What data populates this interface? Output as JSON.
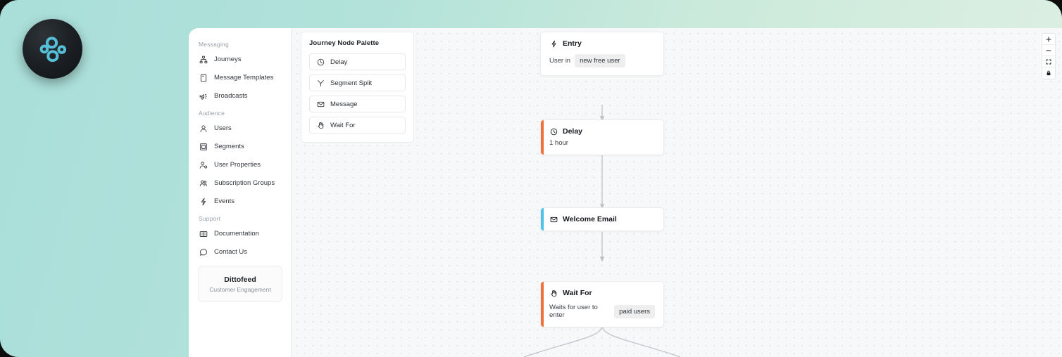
{
  "brand": {
    "logo_icon": "dittofeed-petals-logo",
    "accent_color": "#56bfd8",
    "badge_color": "#16191d"
  },
  "background": {
    "gradient_from": "#a9ded9",
    "gradient_to": "#dff0e3"
  },
  "sidebar": {
    "groups": [
      {
        "label": "Messaging",
        "items": [
          {
            "label": "Journeys",
            "icon": "sitemap-icon"
          },
          {
            "label": "Message Templates",
            "icon": "document-icon"
          },
          {
            "label": "Broadcasts",
            "icon": "megaphone-icon"
          }
        ]
      },
      {
        "label": "Audience",
        "items": [
          {
            "label": "Users",
            "icon": "user-icon"
          },
          {
            "label": "Segments",
            "icon": "segments-icon"
          },
          {
            "label": "User Properties",
            "icon": "user-properties-icon"
          },
          {
            "label": "Subscription Groups",
            "icon": "users-group-icon"
          },
          {
            "label": "Events",
            "icon": "lightning-icon"
          }
        ]
      },
      {
        "label": "Support",
        "items": [
          {
            "label": "Documentation",
            "icon": "book-icon"
          },
          {
            "label": "Contact Us",
            "icon": "chat-bubble-icon"
          }
        ]
      }
    ],
    "brand_card": {
      "name": "Dittofeed",
      "tagline": "Customer Engagement"
    }
  },
  "palette": {
    "title": "Journey Node Palette",
    "items": [
      {
        "label": "Delay",
        "icon": "clock-icon"
      },
      {
        "label": "Segment Split",
        "icon": "split-branch-icon"
      },
      {
        "label": "Message",
        "icon": "envelope-icon"
      },
      {
        "label": "Wait For",
        "icon": "hand-raised-icon"
      }
    ]
  },
  "canvas": {
    "controls": [
      {
        "name": "zoom-in",
        "glyph": "+"
      },
      {
        "name": "zoom-out",
        "glyph": "−"
      },
      {
        "name": "fit-view",
        "glyph": "fit"
      },
      {
        "name": "lock",
        "glyph": "lock"
      }
    ],
    "nodes": [
      {
        "id": "entry",
        "title": "Entry",
        "icon": "lightning-icon",
        "accent": "none",
        "sub_prefix": "User in",
        "chip": "new free user",
        "sub_text": ""
      },
      {
        "id": "delay",
        "title": "Delay",
        "icon": "clock-icon",
        "accent": "#f1713b",
        "sub_prefix": "",
        "chip": "",
        "sub_text": "1 hour"
      },
      {
        "id": "welcome-email",
        "title": "Welcome Email",
        "icon": "envelope-icon",
        "accent": "#4ec3ea",
        "sub_prefix": "",
        "chip": "",
        "sub_text": ""
      },
      {
        "id": "wait-for",
        "title": "Wait For",
        "icon": "hand-raised-icon",
        "accent": "#f1713b",
        "sub_prefix": "Waits for user to enter",
        "chip": "paid users",
        "sub_text": ""
      }
    ]
  }
}
